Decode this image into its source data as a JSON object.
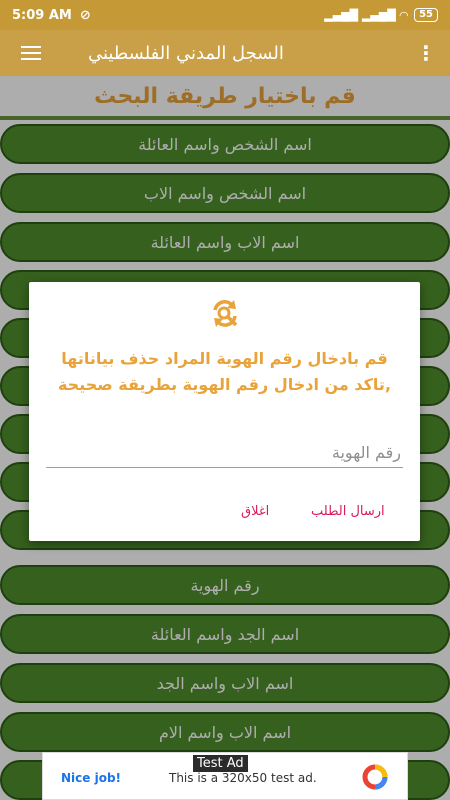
{
  "status_bar": {
    "time": "5:09 AM",
    "battery": "55",
    "signal_text": "▂▄▆█ ▂▄▆█ ◠"
  },
  "app_bar": {
    "title": "السجل المدني الفلسطيني",
    "overflow": "⋮"
  },
  "header": {
    "title": "قم باختيار طريقة البحث"
  },
  "options": [
    "اسم الشخص واسم العائلة",
    "اسم الشخص واسم الاب",
    "اسم الاب واسم العائلة",
    "",
    "",
    "",
    "",
    "",
    "",
    "رقم الهوية",
    "اسم الجد واسم العائلة",
    "اسم الاب واسم الجد",
    "اسم الاب واسم الام"
  ],
  "dialog": {
    "icon": "search-refresh-icon",
    "message": "قم بادخال رقم الهوية المراد حذف بياناتها ,تاكد من ادخال رقم الهوية بطريقة صحيحة",
    "input_placeholder": "رقم الهوية",
    "send_label": "ارسال الطلب",
    "close_label": "اغلاق"
  },
  "ad": {
    "badge": "Test Ad",
    "nice": "Nice job!",
    "text": "This is a 320x50 test ad."
  },
  "colors": {
    "status_bar": "#c59a36",
    "app_bar": "#c9a047",
    "option_green": "#4e8e2c",
    "accent_orange": "#e8a33a",
    "button_pink": "#d81b60"
  }
}
